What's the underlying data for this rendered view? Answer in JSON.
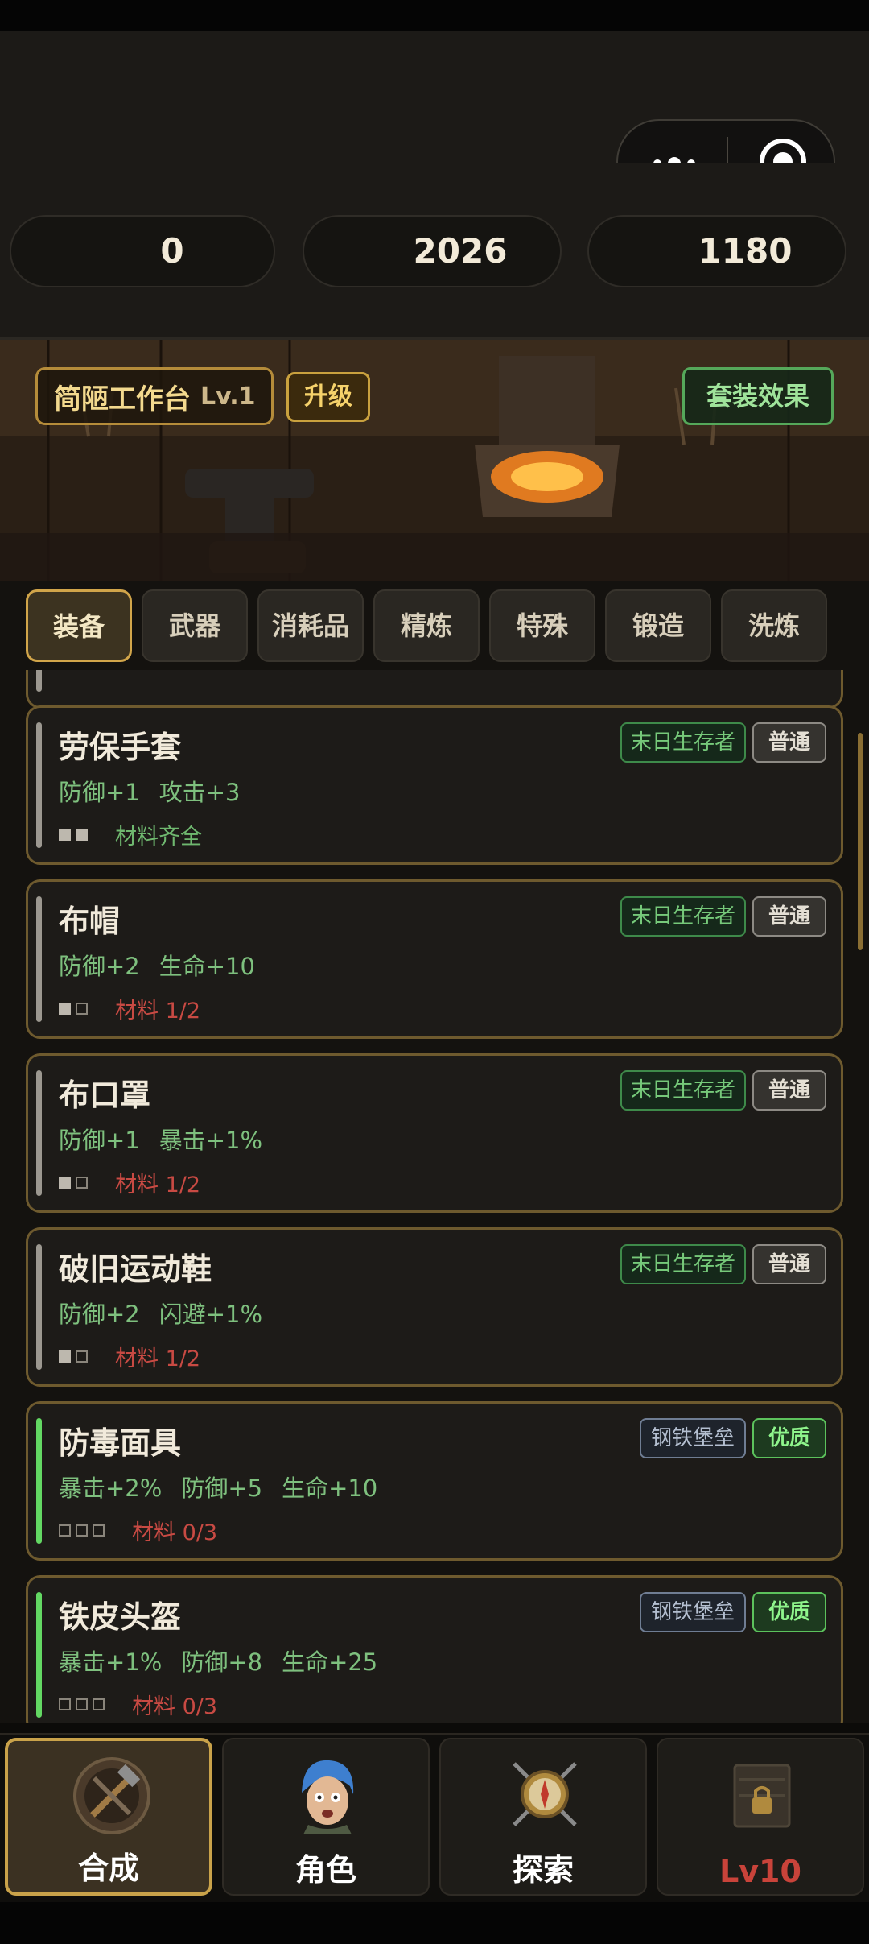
{
  "currency": {
    "gem_purple": "0",
    "diamond": "2026",
    "gold": "1180"
  },
  "workshop": {
    "name": "简陋工作台",
    "level": "Lv.1",
    "upgrade_label": "升级",
    "set_effect_label": "套装效果"
  },
  "tabs": [
    "装备",
    "武器",
    "消耗品",
    "精炼",
    "特殊",
    "锻造",
    "洗炼"
  ],
  "items": [
    {
      "name": "劳保手套",
      "stats": [
        "防御+1",
        "攻击+3"
      ],
      "material": "材料齐全",
      "faction": "末日生存者",
      "quality": "普通"
    },
    {
      "name": "布帽",
      "stats": [
        "防御+2",
        "生命+10"
      ],
      "material": "材料 1/2",
      "faction": "末日生存者",
      "quality": "普通"
    },
    {
      "name": "布口罩",
      "stats": [
        "防御+1",
        "暴击+1%"
      ],
      "material": "材料 1/2",
      "faction": "末日生存者",
      "quality": "普通"
    },
    {
      "name": "破旧运动鞋",
      "stats": [
        "防御+2",
        "闪避+1%"
      ],
      "material": "材料 1/2",
      "faction": "末日生存者",
      "quality": "普通"
    },
    {
      "name": "防毒面具",
      "stats": [
        "暴击+2%",
        "防御+5",
        "生命+10"
      ],
      "material": "材料 0/3",
      "faction": "钢铁堡垒",
      "quality": "优质"
    },
    {
      "name": "铁皮头盔",
      "stats": [
        "暴击+1%",
        "防御+8",
        "生命+25"
      ],
      "material": "材料 0/3",
      "faction": "钢铁堡垒",
      "quality": "优质"
    }
  ],
  "nav": [
    "合成",
    "角色",
    "探索",
    "Lv10"
  ]
}
